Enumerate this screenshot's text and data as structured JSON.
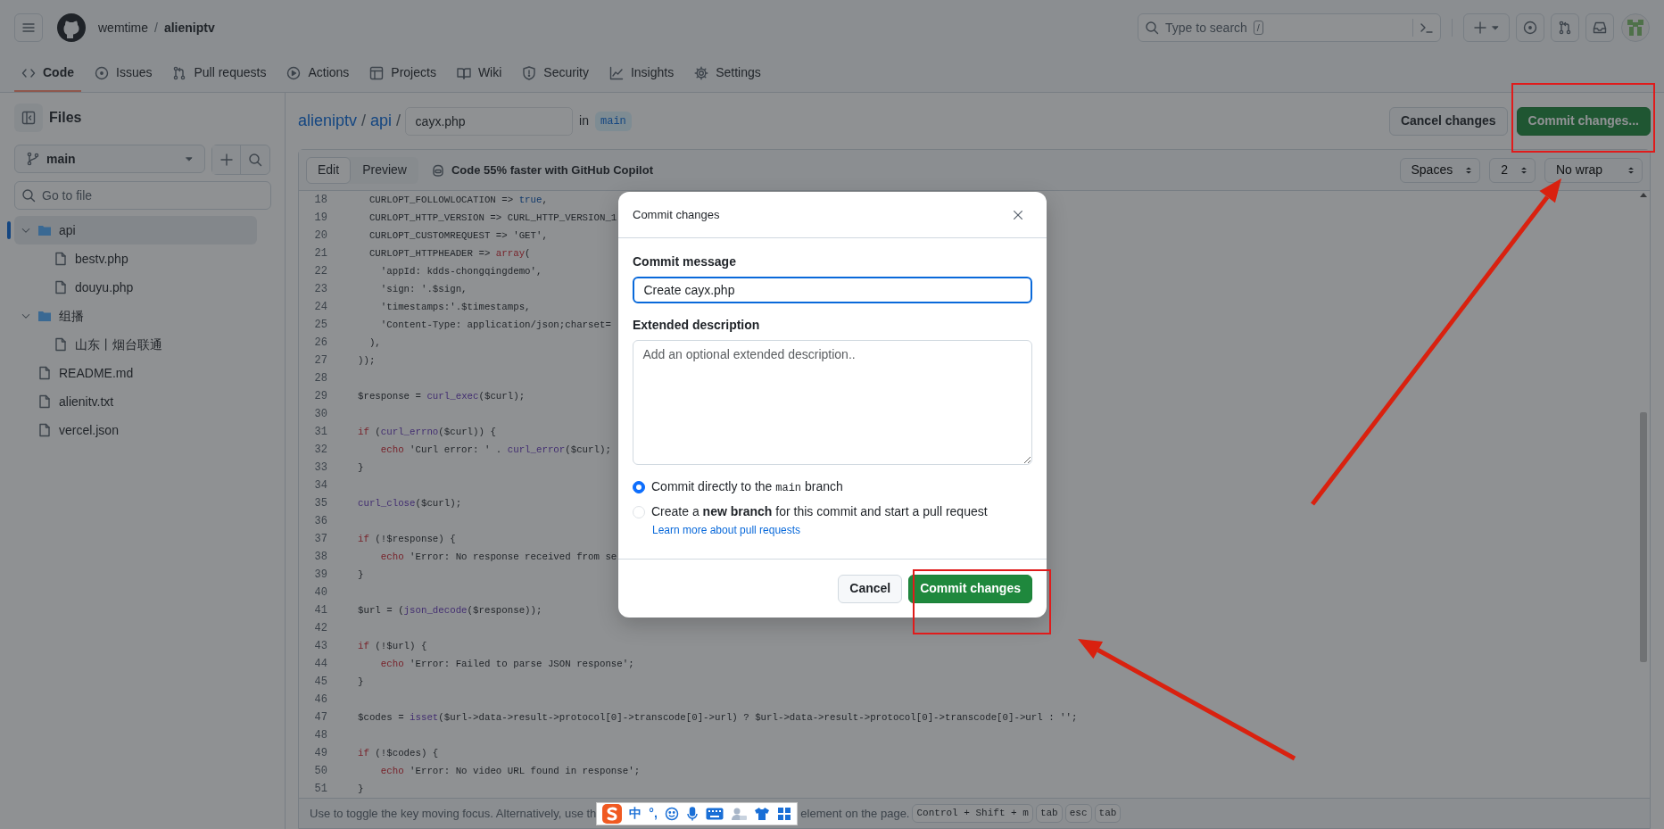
{
  "header": {
    "owner": "wemtime",
    "separator": "/",
    "repo": "alieniptv",
    "search_placeholder": "Type to search",
    "search_key": "/"
  },
  "repo_tabs": [
    {
      "label": "Code",
      "selected": true
    },
    {
      "label": "Issues",
      "selected": false
    },
    {
      "label": "Pull requests",
      "selected": false
    },
    {
      "label": "Actions",
      "selected": false
    },
    {
      "label": "Projects",
      "selected": false
    },
    {
      "label": "Wiki",
      "selected": false
    },
    {
      "label": "Security",
      "selected": false
    },
    {
      "label": "Insights",
      "selected": false
    },
    {
      "label": "Settings",
      "selected": false
    }
  ],
  "sidebar": {
    "title": "Files",
    "branch": "main",
    "search_placeholder": "Go to file",
    "tree": [
      {
        "label": "api",
        "kind": "folder",
        "expanded": true,
        "selected": true,
        "children": [
          {
            "label": "bestv.php",
            "kind": "file",
            "selected": false
          },
          {
            "label": "douyu.php",
            "kind": "file",
            "selected": false
          }
        ]
      },
      {
        "label": "组播",
        "kind": "folder",
        "expanded": true,
        "selected": false,
        "children": [
          {
            "label": "山东丨烟台联通",
            "kind": "file",
            "selected": false
          }
        ]
      },
      {
        "label": "README.md",
        "kind": "file",
        "selected": false
      },
      {
        "label": "alienitv.txt",
        "kind": "file",
        "selected": false
      },
      {
        "label": "vercel.json",
        "kind": "file",
        "selected": false
      }
    ]
  },
  "breadcrumb": [
    {
      "text": "alieniptv",
      "kind": "link"
    },
    {
      "text": "/",
      "kind": "separator"
    },
    {
      "text": "api",
      "kind": "link"
    },
    {
      "text": "/",
      "kind": "separator"
    }
  ],
  "filename": "cayx.php",
  "in_label": "in",
  "branch_badge": "main",
  "actions": [
    {
      "label": "Cancel changes",
      "kind": "secondary"
    },
    {
      "label": "Commit changes...",
      "kind": "primary"
    }
  ],
  "editor": {
    "modes": [
      {
        "label": "Edit",
        "selected": true
      },
      {
        "label": "Preview",
        "selected": false
      }
    ],
    "copilot": "Code 55% faster with GitHub Copilot",
    "selects": [
      "Spaces",
      "2",
      "No wrap"
    ],
    "lines": [
      {
        "number": "18",
        "segments": [
          {
            "text": "  CURLOPT_FOLLOWLOCATION => ",
            "kind": "plain"
          },
          {
            "text": "true",
            "kind": "constant"
          },
          {
            "text": ",",
            "kind": "plain"
          }
        ]
      },
      {
        "number": "19",
        "segments": [
          {
            "text": "  CURLOPT_HTTP_VERSION => CURL_HTTP_VERSION_1",
            "kind": "plain"
          }
        ]
      },
      {
        "number": "20",
        "segments": [
          {
            "text": "  CURLOPT_CUSTOMREQUEST => 'GET',",
            "kind": "plain"
          }
        ]
      },
      {
        "number": "21",
        "segments": [
          {
            "text": "  CURLOPT_HTTPHEADER => ",
            "kind": "plain"
          },
          {
            "text": "array",
            "kind": "keyword"
          },
          {
            "text": "(",
            "kind": "plain"
          }
        ]
      },
      {
        "number": "22",
        "segments": [
          {
            "text": "    'appId: kdds-chongqingdemo',",
            "kind": "plain"
          }
        ]
      },
      {
        "number": "23",
        "segments": [
          {
            "text": "    'sign: '.$sign,",
            "kind": "plain"
          }
        ]
      },
      {
        "number": "24",
        "segments": [
          {
            "text": "    'timestamps:'.$timestamps,",
            "kind": "plain"
          }
        ]
      },
      {
        "number": "25",
        "segments": [
          {
            "text": "    'Content-Type: application/json;charset=",
            "kind": "plain"
          }
        ]
      },
      {
        "number": "26",
        "segments": [
          {
            "text": "  ),",
            "kind": "plain"
          }
        ]
      },
      {
        "number": "27",
        "segments": [
          {
            "text": "));",
            "kind": "plain"
          }
        ]
      },
      {
        "number": "28"
      },
      {
        "number": "29",
        "segments": [
          {
            "text": "$response = ",
            "kind": "plain"
          },
          {
            "text": "curl_exec",
            "kind": "function"
          },
          {
            "text": "($curl);",
            "kind": "plain"
          }
        ]
      },
      {
        "number": "30"
      },
      {
        "number": "31",
        "segments": [
          {
            "text": "if",
            "kind": "keyword"
          },
          {
            "text": " (",
            "kind": "plain"
          },
          {
            "text": "curl_errno",
            "kind": "function"
          },
          {
            "text": "($curl)) {",
            "kind": "plain"
          }
        ]
      },
      {
        "number": "32",
        "segments": [
          {
            "text": "    echo",
            "kind": "keyword"
          },
          {
            "text": " 'Curl error: ' . ",
            "kind": "plain"
          },
          {
            "text": "curl_error",
            "kind": "function"
          },
          {
            "text": "($curl);",
            "kind": "plain"
          }
        ]
      },
      {
        "number": "33",
        "segments": [
          {
            "text": "}",
            "kind": "plain"
          }
        ]
      },
      {
        "number": "34"
      },
      {
        "number": "35",
        "segments": [
          {
            "text": "curl_close",
            "kind": "function"
          },
          {
            "text": "($curl);",
            "kind": "plain"
          }
        ]
      },
      {
        "number": "36"
      },
      {
        "number": "37",
        "segments": [
          {
            "text": "if",
            "kind": "keyword"
          },
          {
            "text": " (!$response) {",
            "kind": "plain"
          }
        ]
      },
      {
        "number": "38",
        "segments": [
          {
            "text": "    echo",
            "kind": "keyword"
          },
          {
            "text": " 'Error: No response received from se",
            "kind": "plain"
          }
        ]
      },
      {
        "number": "39",
        "segments": [
          {
            "text": "}",
            "kind": "plain"
          }
        ]
      },
      {
        "number": "40"
      },
      {
        "number": "41",
        "segments": [
          {
            "text": "$url = (",
            "kind": "plain"
          },
          {
            "text": "json_decode",
            "kind": "function"
          },
          {
            "text": "($response));",
            "kind": "plain"
          }
        ]
      },
      {
        "number": "42"
      },
      {
        "number": "43",
        "segments": [
          {
            "text": "if",
            "kind": "keyword"
          },
          {
            "text": " (!$url) {",
            "kind": "plain"
          }
        ]
      },
      {
        "number": "44",
        "segments": [
          {
            "text": "    echo",
            "kind": "keyword"
          },
          {
            "text": " 'Error: Failed to parse JSON response';",
            "kind": "plain"
          }
        ]
      },
      {
        "number": "45",
        "segments": [
          {
            "text": "}",
            "kind": "plain"
          }
        ]
      },
      {
        "number": "46"
      },
      {
        "number": "47",
        "segments": [
          {
            "text": "$codes = ",
            "kind": "plain"
          },
          {
            "text": "isset",
            "kind": "function"
          },
          {
            "text": "($url->data->result->protocol[0]->transcode[0]->url) ? $url->data->result->protocol[0]->transcode[0]->url : '';",
            "kind": "plain"
          }
        ]
      },
      {
        "number": "48"
      },
      {
        "number": "49",
        "segments": [
          {
            "text": "if",
            "kind": "keyword"
          },
          {
            "text": " (!$codes) {",
            "kind": "plain"
          }
        ]
      },
      {
        "number": "50",
        "segments": [
          {
            "text": "    echo",
            "kind": "keyword"
          },
          {
            "text": " 'Error: No video URL found in response';",
            "kind": "plain"
          }
        ]
      },
      {
        "number": "51",
        "segments": [
          {
            "text": "}",
            "kind": "plain"
          }
        ]
      }
    ]
  },
  "footer": {
    "text_before": "Use to toggle the key moving focus. Alternatively, use th",
    "text_after": "element on the page.",
    "keys": [
      "Control + Shift + m",
      "tab",
      "esc",
      "tab"
    ]
  },
  "ime": {
    "mode": "中",
    "punctuation": "°,"
  },
  "modal": {
    "title": "Commit changes",
    "message_label": "Commit message",
    "message_value": "Create cayx.php",
    "description_label": "Extended description",
    "description_placeholder": "Add an optional extended description..",
    "options": [
      {
        "before": "Commit directly to the",
        "code": "main",
        "after": "branch",
        "selected": true
      },
      {
        "text": "Create a **new branch** for this commit and start a pull request",
        "selected": false
      }
    ],
    "learn_link": "Learn more about pull requests",
    "buttons": [
      {
        "label": "Cancel",
        "kind": "secondary"
      },
      {
        "label": "Commit changes",
        "kind": "primary"
      }
    ]
  }
}
